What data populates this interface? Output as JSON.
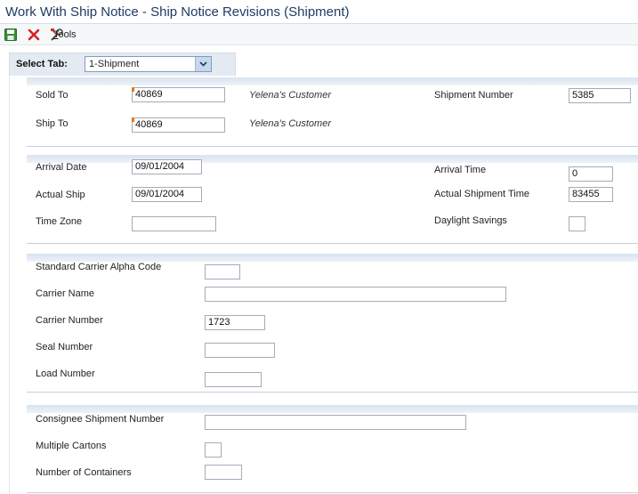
{
  "window": {
    "title": "Work With Ship Notice - Ship Notice Revisions (Shipment)"
  },
  "toolbar": {
    "save_icon": "save-icon",
    "cancel_icon": "cancel-icon",
    "tools_label": "Tools",
    "tools_mnemonic": "T",
    "tools_rest": "ools"
  },
  "tab": {
    "label": "Select Tab:",
    "selected": "1-Shipment"
  },
  "section1": {
    "sold_to_label": "Sold To",
    "sold_to_value": "40869",
    "sold_to_name": "Yelena's Customer",
    "ship_to_label": "Ship To",
    "ship_to_value": "40869",
    "ship_to_name": "Yelena's Customer",
    "shipment_number_label": "Shipment Number",
    "shipment_number_value": "5385"
  },
  "section2": {
    "arrival_date_label": "Arrival Date",
    "arrival_date_value": "09/01/2004",
    "actual_ship_label": "Actual Ship",
    "actual_ship_value": "09/01/2004",
    "time_zone_label": "Time Zone",
    "time_zone_value": "",
    "arrival_time_label": "Arrival Time",
    "arrival_time_value": "0",
    "actual_shipment_time_label": "Actual Shipment Time",
    "actual_shipment_time_value": "83455",
    "daylight_savings_label": "Daylight Savings",
    "daylight_savings_value": ""
  },
  "section3": {
    "scac_label": "Standard Carrier Alpha Code",
    "scac_value": "",
    "carrier_name_label": "Carrier Name",
    "carrier_name_value": "",
    "carrier_number_label": "Carrier Number",
    "carrier_number_value": "1723",
    "seal_number_label": "Seal Number",
    "seal_number_value": "",
    "load_number_label": "Load Number",
    "load_number_value": ""
  },
  "section4": {
    "consignee_label": "Consignee Shipment Number",
    "consignee_value": "",
    "multiple_cartons_label": "Multiple Cartons",
    "multiple_cartons_value": "",
    "containers_label": "Number of Containers",
    "containers_value": ""
  },
  "colors": {
    "title_text": "#1f3b63",
    "required_marker": "#e07a1f",
    "band": "#d9e3ef"
  }
}
